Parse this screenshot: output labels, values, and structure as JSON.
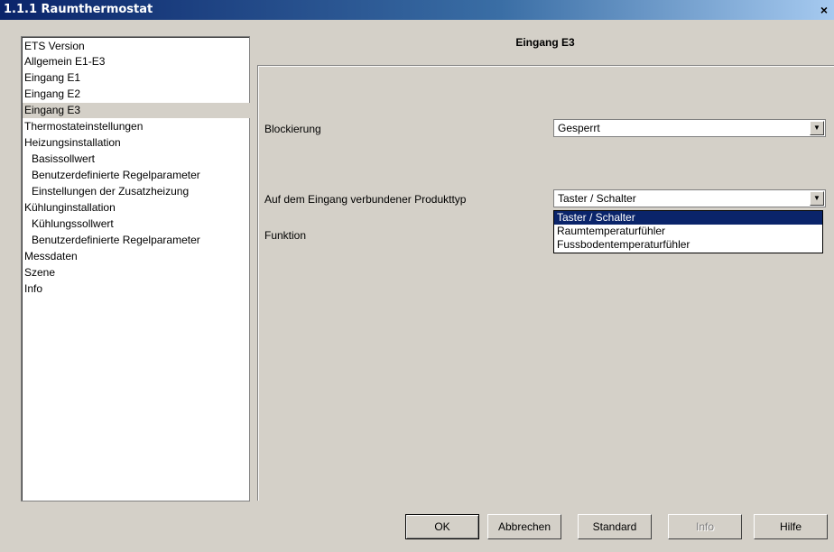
{
  "window": {
    "title": "1.1.1 Raumthermostat",
    "close_label": "×"
  },
  "tree": {
    "items": [
      {
        "label": "ETS Version"
      },
      {
        "label": "Allgemein E1-E3"
      },
      {
        "label": "Eingang E1"
      },
      {
        "label": "Eingang E2"
      },
      {
        "label": "Eingang E3"
      },
      {
        "label": "Thermostateinstellungen"
      },
      {
        "label": "Heizungsinstallation"
      },
      {
        "label": "Basissollwert"
      },
      {
        "label": "Benutzerdefinierte Regelparameter"
      },
      {
        "label": "Einstellungen der Zusatzheizung"
      },
      {
        "label": "Kühlunginstallation"
      },
      {
        "label": "Kühlungssollwert"
      },
      {
        "label": "Benutzerdefinierte Regelparameter"
      },
      {
        "label": "Messdaten"
      },
      {
        "label": "Szene"
      },
      {
        "label": "Info"
      }
    ]
  },
  "panel": {
    "title": "Eingang E3",
    "blockierung": {
      "label": "Blockierung",
      "value": "Gesperrt"
    },
    "produkttyp": {
      "label": "Auf dem Eingang verbundener Produkttyp",
      "value": "Taster / Schalter",
      "options": [
        "Taster / Schalter",
        "Raumtemperaturfühler",
        "Fussbodentemperaturfühler"
      ]
    },
    "funktion": {
      "label": "Funktion"
    }
  },
  "buttons": {
    "ok": "OK",
    "cancel": "Abbrechen",
    "standard": "Standard",
    "info": "Info",
    "help": "Hilfe"
  },
  "colors": {
    "selection": "#0a246a",
    "face": "#d4d0c8"
  }
}
